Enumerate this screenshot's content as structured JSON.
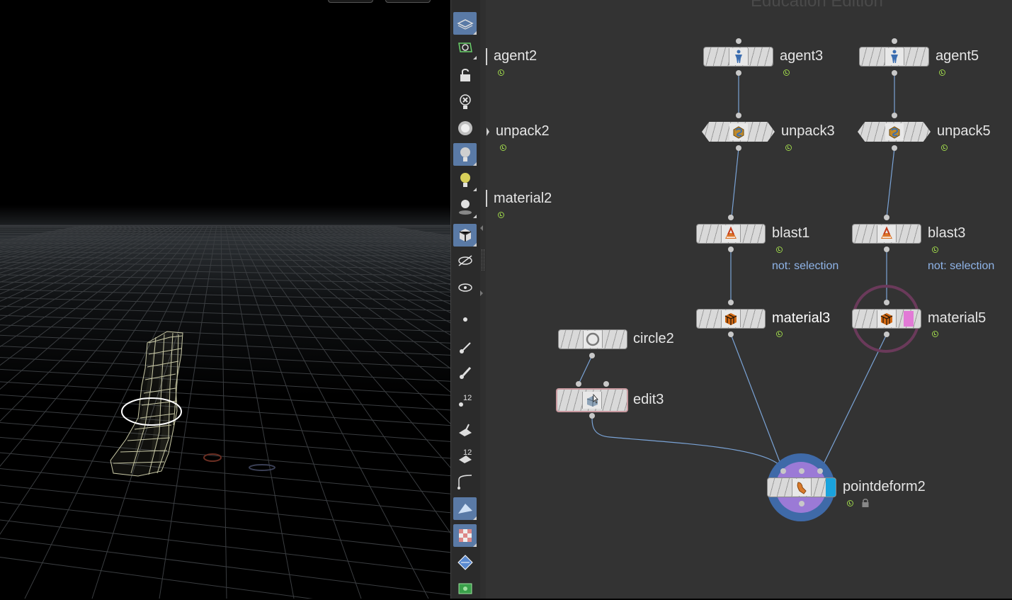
{
  "app": {
    "watermark": "Education Edition"
  },
  "shelf": {
    "tools": [
      {
        "name": "display-options-icon",
        "active": true
      },
      {
        "name": "ghost-other-objects-icon",
        "active": false
      },
      {
        "name": "lock-camera-icon",
        "active": false
      },
      {
        "name": "no-lighting-icon",
        "active": false
      },
      {
        "name": "headlight-icon",
        "active": false
      },
      {
        "name": "normal-lighting-icon",
        "active": true
      },
      {
        "name": "high-quality-lighting-icon",
        "active": false
      },
      {
        "name": "high-quality-shadows-icon",
        "active": false
      },
      {
        "name": "shaded-mode-icon",
        "active": true
      },
      {
        "name": "hide-other-objects-icon",
        "active": false
      },
      {
        "name": "template-mode-icon",
        "active": false
      },
      {
        "name": "point-display-icon",
        "active": false
      },
      {
        "name": "point-normal-icon",
        "active": false
      },
      {
        "name": "point-uv-icon",
        "active": false
      },
      {
        "name": "point-numbers-icon",
        "active": false,
        "text": "12"
      },
      {
        "name": "primitive-normal-icon",
        "active": false
      },
      {
        "name": "primitive-numbers-icon",
        "active": false,
        "text": "12"
      },
      {
        "name": "hull-display-icon",
        "active": false
      },
      {
        "name": "shaded-faces-icon",
        "active": true
      },
      {
        "name": "uv-checker-icon",
        "active": true
      },
      {
        "name": "vertex-display-icon",
        "active": false
      },
      {
        "name": "bounding-box-icon",
        "active": false
      }
    ]
  },
  "network": {
    "nodes": {
      "agent2": {
        "label": "agent2"
      },
      "unpack2": {
        "label": "unpack2"
      },
      "material2": {
        "label": "material2"
      },
      "agent3": {
        "label": "agent3"
      },
      "agent5": {
        "label": "agent5"
      },
      "unpack3": {
        "label": "unpack3"
      },
      "unpack5": {
        "label": "unpack5"
      },
      "blast1": {
        "label": "blast1",
        "comment": "not: selection"
      },
      "blast3": {
        "label": "blast3",
        "comment": "not: selection"
      },
      "material3": {
        "label": "material3"
      },
      "material5": {
        "label": "material5"
      },
      "circle2": {
        "label": "circle2"
      },
      "edit3": {
        "label": "edit3"
      },
      "pointdeform2": {
        "label": "pointdeform2"
      }
    },
    "colors": {
      "wire": "#7aa3d6",
      "comment": "#8fb4e8",
      "status": "#9bd24a",
      "template_ring": "#6a3a5a",
      "display_ring": "#3f6aa8",
      "render_flag": "#1aa3dd",
      "bypass_flag": "#e27ad6"
    }
  }
}
